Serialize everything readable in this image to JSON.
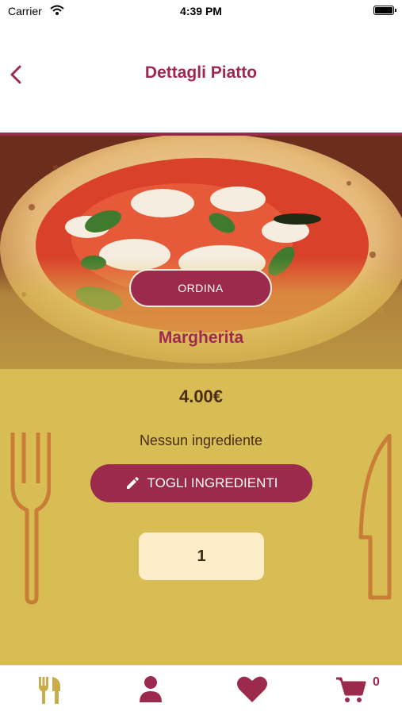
{
  "status_bar": {
    "carrier": "Carrier",
    "time": "4:39 PM"
  },
  "nav": {
    "title": "Dettagli Piatto"
  },
  "dish": {
    "order_label": "ORDINA",
    "name": "Margherita",
    "price": "4.00€",
    "ingredients_text": "Nessun ingrediente",
    "remove_ingredients_label": "TOGLI INGREDIENTI",
    "quantity": "1"
  },
  "tab_bar": {
    "tabs": [
      {
        "icon": "utensils-icon",
        "active": true
      },
      {
        "icon": "user-icon",
        "active": false
      },
      {
        "icon": "heart-icon",
        "active": false
      },
      {
        "icon": "cart-icon",
        "active": false
      }
    ],
    "cart_count": "0"
  },
  "colors": {
    "accent": "#9b2a4d",
    "title": "#a0284f",
    "detail_bg": "#d8bd55",
    "decor": "#c97d36",
    "quantity_bg": "#fdeec9",
    "active_tab": "#c9ad4c"
  }
}
